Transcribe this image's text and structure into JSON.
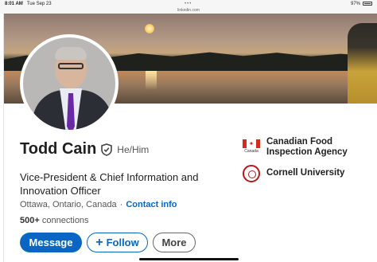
{
  "status_bar": {
    "time": "8:01 AM",
    "date": "Tue Sep 23",
    "battery": "97%"
  },
  "browser": {
    "url": "linkedin.com"
  },
  "profile": {
    "name": "Todd Cain",
    "pronouns": "He/Him",
    "headline": "Vice-President & Chief Information and Innovation Officer",
    "location": "Ottawa, Ontario, Canada",
    "location_separator": "·",
    "contact_info_label": "Contact info",
    "connections_count": "500+",
    "connections_label": "connections"
  },
  "actions": {
    "message_label": "Message",
    "follow_label": "Follow",
    "follow_icon": "+",
    "more_label": "More"
  },
  "organizations": [
    {
      "name": "Canadian Food Inspection Agency",
      "logo": "canada-flag-icon",
      "logo_text": "Canada"
    },
    {
      "name": "Cornell University",
      "logo": "cornell-seal-icon"
    }
  ],
  "colors": {
    "primary": "#0a66c2",
    "flag_red": "#d52b1e",
    "cornell_red": "#b31b1b",
    "tie": "#6a2aa3"
  }
}
